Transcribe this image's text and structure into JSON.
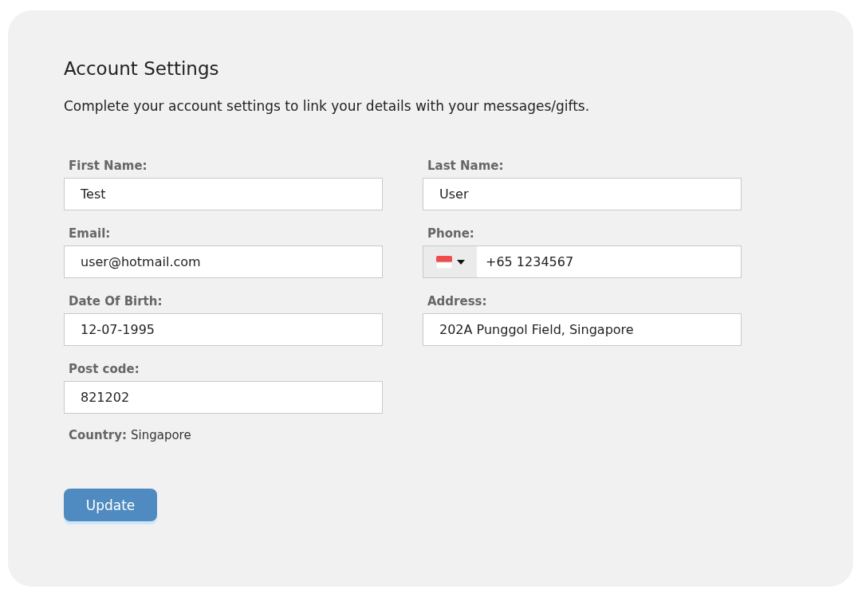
{
  "title": "Account Settings",
  "subtitle": "Complete your account settings to link your details with your messages/gifts.",
  "fields": [
    {
      "kind": "text",
      "label": "First Name:",
      "value": "Test"
    },
    {
      "kind": "text",
      "label": "Last Name:",
      "value": "User"
    },
    {
      "kind": "text",
      "label": "Email:",
      "value": "user@hotmail.com"
    },
    {
      "kind": "phone",
      "label": "Phone:",
      "value": "+65 1234567"
    },
    {
      "kind": "text",
      "label": "Date Of Birth:",
      "value": "12-07-1995"
    },
    {
      "kind": "text",
      "label": "Address:",
      "value": "202A Punggol Field, Singapore"
    },
    {
      "kind": "text",
      "label": "Post code:",
      "value": "821202"
    }
  ],
  "country": {
    "label": "Country:",
    "value": "Singapore"
  },
  "button": "Update"
}
